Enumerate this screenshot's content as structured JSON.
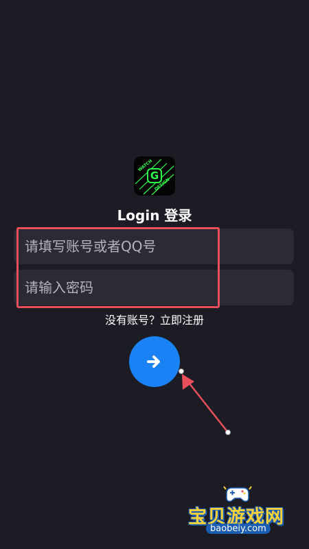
{
  "login": {
    "title": "Login 登录",
    "account_placeholder": "请填写账号或者QQ号",
    "password_placeholder": "请输入密码",
    "register_text": "没有账号？立即注册",
    "submit_icon": "arrow-right-icon"
  },
  "logo": {
    "icon": "watch-designer-logo"
  },
  "watermark": {
    "name": "宝贝游戏网",
    "domain": "baobeiy.com"
  },
  "colors": {
    "background": "#1c1c24",
    "input_background": "#2b2b35",
    "accent": "#1a82f4",
    "highlight": "#e8505b",
    "logo_green": "#2cff4a"
  }
}
